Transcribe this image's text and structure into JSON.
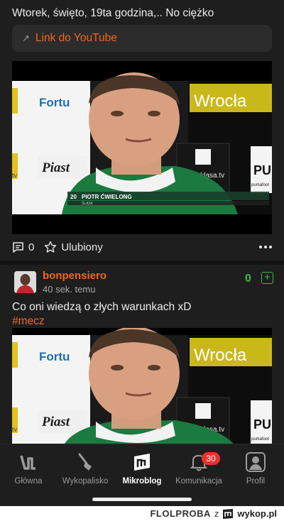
{
  "post1": {
    "text": "Wtorek, święto, 19ta godzina,.. No ciężko",
    "link_label": "Link do YouTube",
    "video": {
      "sponsor_left": "Fortu",
      "sponsor_right": "Wrocła",
      "brand_piast": "Piast",
      "brand_ekstraklasa": "ekstraklasa.tv",
      "brand_puma": "PU",
      "brand_puma_small": "pumafoot",
      "caption_number": "20",
      "caption_name": "PIOTR ĆWIELONG",
      "caption_club": "ŚLĄSK",
      "channel": "tv"
    },
    "comments_count": "0",
    "favorite_label": "Ulubiony"
  },
  "post2": {
    "username": "bonpensiero",
    "time": "40 sek. temu",
    "votes": "0",
    "text": "Co oni wiedzą o złych warunkach xD",
    "hashtag": "#mecz",
    "video": {
      "sponsor_left": "Fortu",
      "sponsor_right": "Wrocła",
      "brand_piast": "Piast",
      "brand_ekstraklasa": "ekstraklasa.tv",
      "brand_puma": "PU",
      "brand_puma_small": "pumafoot",
      "channel": "tv"
    }
  },
  "nav": {
    "items": [
      {
        "label": "Główna"
      },
      {
        "label": "Wykopalisko"
      },
      {
        "label": "Mikroblog"
      },
      {
        "label": "Komunikacja",
        "badge": "30"
      },
      {
        "label": "Profil"
      }
    ]
  },
  "footer": {
    "source": "FLOLPROBA",
    "separator": "z",
    "brand": "wykop.pl"
  },
  "colors": {
    "accent": "#f26622",
    "vote_green": "#3db84a",
    "badge_red": "#e8322f",
    "background": "#121212",
    "card": "#1e1e1e"
  }
}
